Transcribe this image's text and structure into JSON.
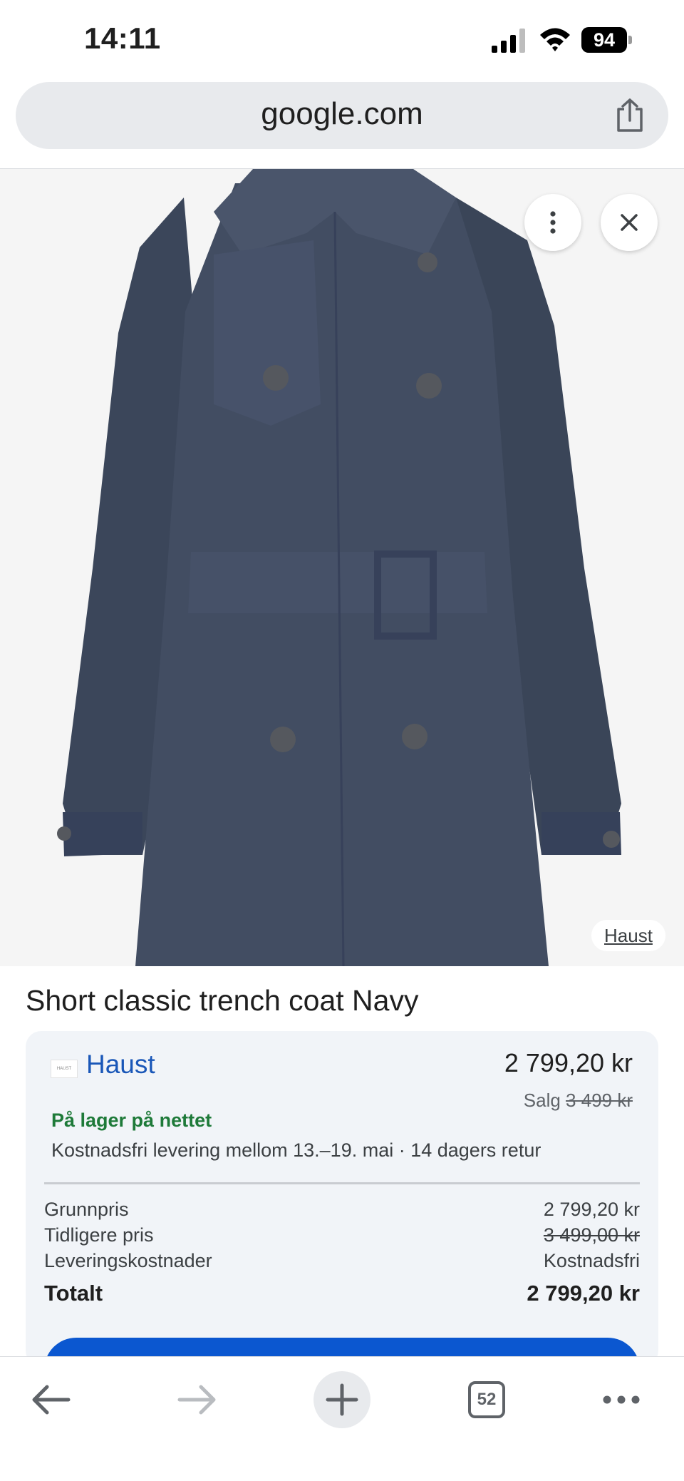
{
  "status_bar": {
    "time": "14:11",
    "battery_level": "94",
    "icons": [
      "signal-icon",
      "wifi-icon",
      "battery-icon"
    ]
  },
  "browser": {
    "url": "google.com",
    "icons": [
      "share-icon"
    ]
  },
  "product_image": {
    "overlay_icons": [
      "more-vert-icon",
      "close-icon"
    ],
    "source_label": "Haust"
  },
  "product": {
    "title": "Short classic trench coat Navy",
    "offer": {
      "merchant": "Haust",
      "merchant_logo_text": "HAUST",
      "price": "2 799,20 kr",
      "sale_label": "Salg",
      "original_price": "3 499 kr",
      "stock": "På lager på nettet",
      "delivery": "Kostnadsfri levering mellom 13.–19. mai · 14 dagers retur",
      "breakdown": [
        {
          "label": "Grunnpris",
          "value": "2 799,20 kr"
        },
        {
          "label": "Tidligere pris",
          "value": "3 499,00 kr"
        },
        {
          "label": "Leveringskostnader",
          "value": "Kostnadsfri"
        }
      ],
      "total_label": "Totalt",
      "total_value": "2 799,20 kr"
    }
  },
  "toolbar": {
    "tab_count": "52",
    "icons": [
      "back-arrow-icon",
      "forward-arrow-icon",
      "plus-icon",
      "tabs-icon",
      "more-horiz-icon"
    ]
  },
  "colors": {
    "link_blue": "#1a57b8",
    "stock_green": "#1e7a39",
    "button_blue": "#0b57d0",
    "coat_navy": "#3f4a5f"
  }
}
